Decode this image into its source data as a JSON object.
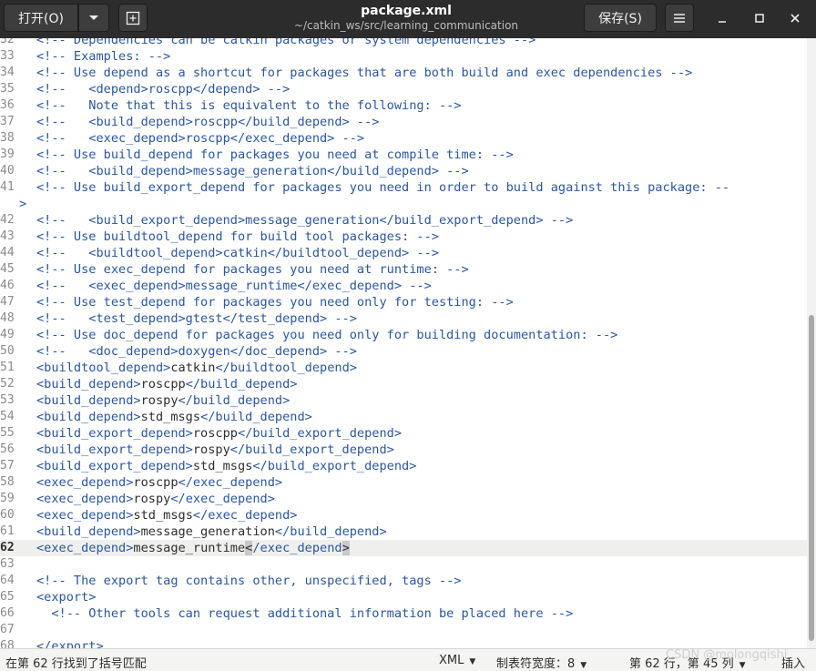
{
  "header": {
    "open_label": "打开(O)",
    "title": "package.xml",
    "path": "~/catkin_ws/src/learning_communication",
    "save_label": "保存(S)"
  },
  "icons": {
    "open_dropdown": "chevron-down-icon",
    "new_tab": "new-tab-icon",
    "menu": "hamburger-menu-icon",
    "minimize": "minimize-icon",
    "maximize": "maximize-icon",
    "close": "close-icon"
  },
  "colors": {
    "header_bg": "#2c2c2c",
    "tag_color": "#2a56a0",
    "text_color": "#2e2e2e",
    "current_line_bg": "#efefed"
  },
  "editor": {
    "lines": [
      {
        "n": "32",
        "segs": [
          [
            "cm",
            "<!-- Dependencies can be catkin packages or system dependencies -->"
          ]
        ]
      },
      {
        "n": "33",
        "segs": [
          [
            "cm",
            "<!-- Examples: -->"
          ]
        ]
      },
      {
        "n": "34",
        "segs": [
          [
            "cm",
            "<!-- Use depend as a shortcut for packages that are both build and exec dependencies -->"
          ]
        ]
      },
      {
        "n": "35",
        "segs": [
          [
            "cm",
            "<!--   <depend>roscpp</depend> -->"
          ]
        ]
      },
      {
        "n": "36",
        "segs": [
          [
            "cm",
            "<!--   Note that this is equivalent to the following: -->"
          ]
        ]
      },
      {
        "n": "37",
        "segs": [
          [
            "cm",
            "<!--   <build_depend>roscpp</build_depend> -->"
          ]
        ]
      },
      {
        "n": "38",
        "segs": [
          [
            "cm",
            "<!--   <exec_depend>roscpp</exec_depend> -->"
          ]
        ]
      },
      {
        "n": "39",
        "segs": [
          [
            "cm",
            "<!-- Use build_depend for packages you need at compile time: -->"
          ]
        ]
      },
      {
        "n": "40",
        "segs": [
          [
            "cm",
            "<!--   <build_depend>message_generation</build_depend> -->"
          ]
        ]
      },
      {
        "n": "41",
        "segs": [
          [
            "cm",
            "<!-- Use build_export_depend for packages you need in order to build against this package: --"
          ]
        ],
        "cont": ">"
      },
      {
        "n": "42",
        "segs": [
          [
            "cm",
            "<!--   <build_export_depend>message_generation</build_export_depend> -->"
          ]
        ]
      },
      {
        "n": "43",
        "segs": [
          [
            "cm",
            "<!-- Use buildtool_depend for build tool packages: -->"
          ]
        ]
      },
      {
        "n": "44",
        "segs": [
          [
            "cm",
            "<!--   <buildtool_depend>catkin</buildtool_depend> -->"
          ]
        ]
      },
      {
        "n": "45",
        "segs": [
          [
            "cm",
            "<!-- Use exec_depend for packages you need at runtime: -->"
          ]
        ]
      },
      {
        "n": "46",
        "segs": [
          [
            "cm",
            "<!--   <exec_depend>message_runtime</exec_depend> -->"
          ]
        ]
      },
      {
        "n": "47",
        "segs": [
          [
            "cm",
            "<!-- Use test_depend for packages you need only for testing: -->"
          ]
        ]
      },
      {
        "n": "48",
        "segs": [
          [
            "cm",
            "<!--   <test_depend>gtest</test_depend> -->"
          ]
        ]
      },
      {
        "n": "49",
        "segs": [
          [
            "cm",
            "<!-- Use doc_depend for packages you need only for building documentation: -->"
          ]
        ]
      },
      {
        "n": "50",
        "segs": [
          [
            "cm",
            "<!--   <doc_depend>doxygen</doc_depend> -->"
          ]
        ]
      },
      {
        "n": "51",
        "segs": [
          [
            "tg",
            "<buildtool_depend>"
          ],
          [
            "tx",
            "catkin"
          ],
          [
            "tg",
            "</buildtool_depend>"
          ]
        ]
      },
      {
        "n": "52",
        "segs": [
          [
            "tg",
            "<build_depend>"
          ],
          [
            "tx",
            "roscpp"
          ],
          [
            "tg",
            "</build_depend>"
          ]
        ]
      },
      {
        "n": "53",
        "segs": [
          [
            "tg",
            "<build_depend>"
          ],
          [
            "tx",
            "rospy"
          ],
          [
            "tg",
            "</build_depend>"
          ]
        ]
      },
      {
        "n": "54",
        "segs": [
          [
            "tg",
            "<build_depend>"
          ],
          [
            "tx",
            "std_msgs"
          ],
          [
            "tg",
            "</build_depend>"
          ]
        ]
      },
      {
        "n": "55",
        "segs": [
          [
            "tg",
            "<build_export_depend>"
          ],
          [
            "tx",
            "roscpp"
          ],
          [
            "tg",
            "</build_export_depend>"
          ]
        ]
      },
      {
        "n": "56",
        "segs": [
          [
            "tg",
            "<build_export_depend>"
          ],
          [
            "tx",
            "rospy"
          ],
          [
            "tg",
            "</build_export_depend>"
          ]
        ]
      },
      {
        "n": "57",
        "segs": [
          [
            "tg",
            "<build_export_depend>"
          ],
          [
            "tx",
            "std_msgs"
          ],
          [
            "tg",
            "</build_export_depend>"
          ]
        ]
      },
      {
        "n": "58",
        "segs": [
          [
            "tg",
            "<exec_depend>"
          ],
          [
            "tx",
            "roscpp"
          ],
          [
            "tg",
            "</exec_depend>"
          ]
        ]
      },
      {
        "n": "59",
        "segs": [
          [
            "tg",
            "<exec_depend>"
          ],
          [
            "tx",
            "rospy"
          ],
          [
            "tg",
            "</exec_depend>"
          ]
        ]
      },
      {
        "n": "60",
        "segs": [
          [
            "tg",
            "<exec_depend>"
          ],
          [
            "tx",
            "std_msgs"
          ],
          [
            "tg",
            "</exec_depend>"
          ]
        ]
      },
      {
        "n": "61",
        "segs": [
          [
            "tg",
            "<build_depend>"
          ],
          [
            "tx",
            "message_generation"
          ],
          [
            "tg",
            "</build_depend>"
          ]
        ]
      },
      {
        "n": "62",
        "current": true,
        "segs": [
          [
            "tg",
            "<exec_depend>"
          ],
          [
            "tx",
            "message_runtime"
          ],
          [
            "bm",
            "<"
          ],
          [
            "tg",
            "/exec_depend"
          ],
          [
            "bm",
            ">"
          ]
        ]
      },
      {
        "n": "63",
        "segs": []
      },
      {
        "n": "64",
        "segs": [
          [
            "cm",
            "<!-- The export tag contains other, unspecified, tags -->"
          ]
        ]
      },
      {
        "n": "65",
        "segs": [
          [
            "tg",
            "<export>"
          ]
        ]
      },
      {
        "n": "66",
        "segs": [
          [
            "cm",
            "  <!-- Other tools can request additional information be placed here -->"
          ]
        ]
      },
      {
        "n": "67",
        "segs": []
      },
      {
        "n": "68",
        "segs": [
          [
            "tg",
            "</export>"
          ]
        ]
      }
    ]
  },
  "statusbar": {
    "message": "在第 62 行找到了括号匹配",
    "language": "XML",
    "tab_width": "制表符宽度：8",
    "position": "第 62 行，第 45 列",
    "mode": "插入",
    "watermark": "CSDN @molongqishi"
  }
}
